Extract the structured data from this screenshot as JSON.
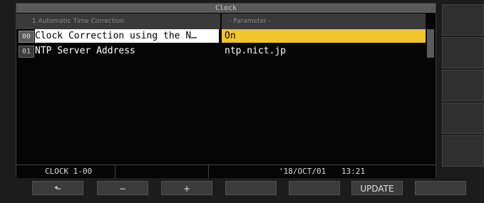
{
  "window": {
    "title": "Clock"
  },
  "columns": {
    "left": "1 Automatic Time Correction",
    "right": "- Parameter -"
  },
  "rows": [
    {
      "index": "00",
      "label": "Clock Correction using the N…",
      "value": "On"
    },
    {
      "index": "01",
      "label": "NTP Server Address",
      "value": "ntp.nict.jp"
    }
  ],
  "status": {
    "id": "CLOCK 1-00",
    "date": "'18/OCT/01",
    "time": "13:21"
  },
  "softkeys": [
    "⬑",
    "−",
    "+",
    "",
    "",
    "UPDATE",
    ""
  ],
  "colors": {
    "selected_value": "#f2c52a",
    "screen_bg": "#050505",
    "title_bar": "#5a5a5a"
  }
}
